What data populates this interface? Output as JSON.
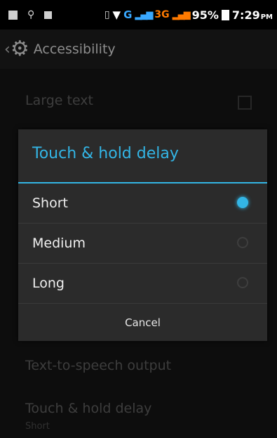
{
  "status_bar": {
    "network_g": "G",
    "network_3g": "3G",
    "battery_pct": "95%",
    "time": "7:29",
    "ampm": "PM"
  },
  "action_bar": {
    "title": "Accessibility"
  },
  "settings": {
    "large_text": "Large text",
    "tts_output": "Text-to-speech output",
    "touch_hold_delay": "Touch & hold delay",
    "touch_hold_value": "Short"
  },
  "dialog": {
    "title": "Touch & hold delay",
    "options": [
      {
        "label": "Short",
        "selected": true
      },
      {
        "label": "Medium",
        "selected": false
      },
      {
        "label": "Long",
        "selected": false
      }
    ],
    "cancel_label": "Cancel"
  },
  "colors": {
    "accent": "#33b5e5",
    "network_3g": "#ff7a00"
  }
}
